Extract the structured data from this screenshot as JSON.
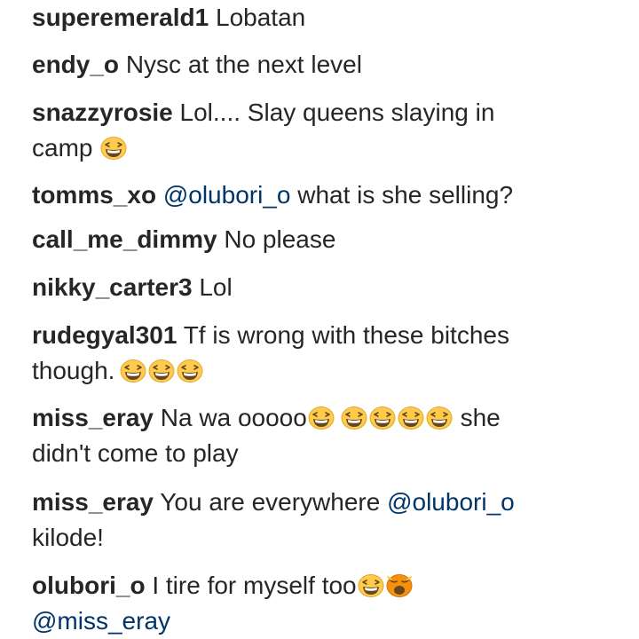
{
  "comments": [
    {
      "user": "superemerald1",
      "text": "Lobatan"
    },
    {
      "user": "endy_o",
      "text": "Nysc at the next level"
    },
    {
      "user": "snazzyrosie",
      "text_line1": "Lol.... Slay queens slaying in",
      "text_line2": "camp",
      "emojis": [
        "grinning-squinting-face-icon"
      ]
    },
    {
      "user": "tomms_xo",
      "mention": "@olubori_o",
      "text": "what is she selling?"
    },
    {
      "user": "call_me_dimmy",
      "text": "No please"
    },
    {
      "user": "nikky_carter3",
      "text": "Lol"
    },
    {
      "user": "rudegyal301",
      "text_line1": "Tf is wrong with these bitches",
      "text_line2": "though.",
      "emojis": [
        "grinning-squinting-face-icon",
        "grinning-squinting-face-icon",
        "grinning-squinting-face-icon"
      ]
    },
    {
      "user": "miss_eray",
      "text_before": "Na wa ooooo",
      "text_after": "she",
      "text_line2": "didn't come to play",
      "emojis": [
        "grinning-squinting-face-icon",
        "grinning-squinting-face-icon",
        "grinning-squinting-face-icon",
        "grinning-squinting-face-icon",
        "grinning-squinting-face-icon"
      ]
    },
    {
      "user": "miss_eray",
      "text": "You are everywhere",
      "mention": "@olubori_o",
      "text_line2": "kilode!"
    },
    {
      "user": "olubori_o",
      "text": "I tire for myself too",
      "mention_line2": "@miss_eray",
      "emojis": [
        "grinning-squinting-face-icon",
        "weary-face-icon"
      ]
    }
  ],
  "colors": {
    "text": "#262626",
    "mention": "#003569",
    "emoji_face": "#FFCB4C",
    "emoji_outline": "#E0A82E",
    "emoji_mouth": "#65471B",
    "emoji_weary": "#F4900C"
  }
}
